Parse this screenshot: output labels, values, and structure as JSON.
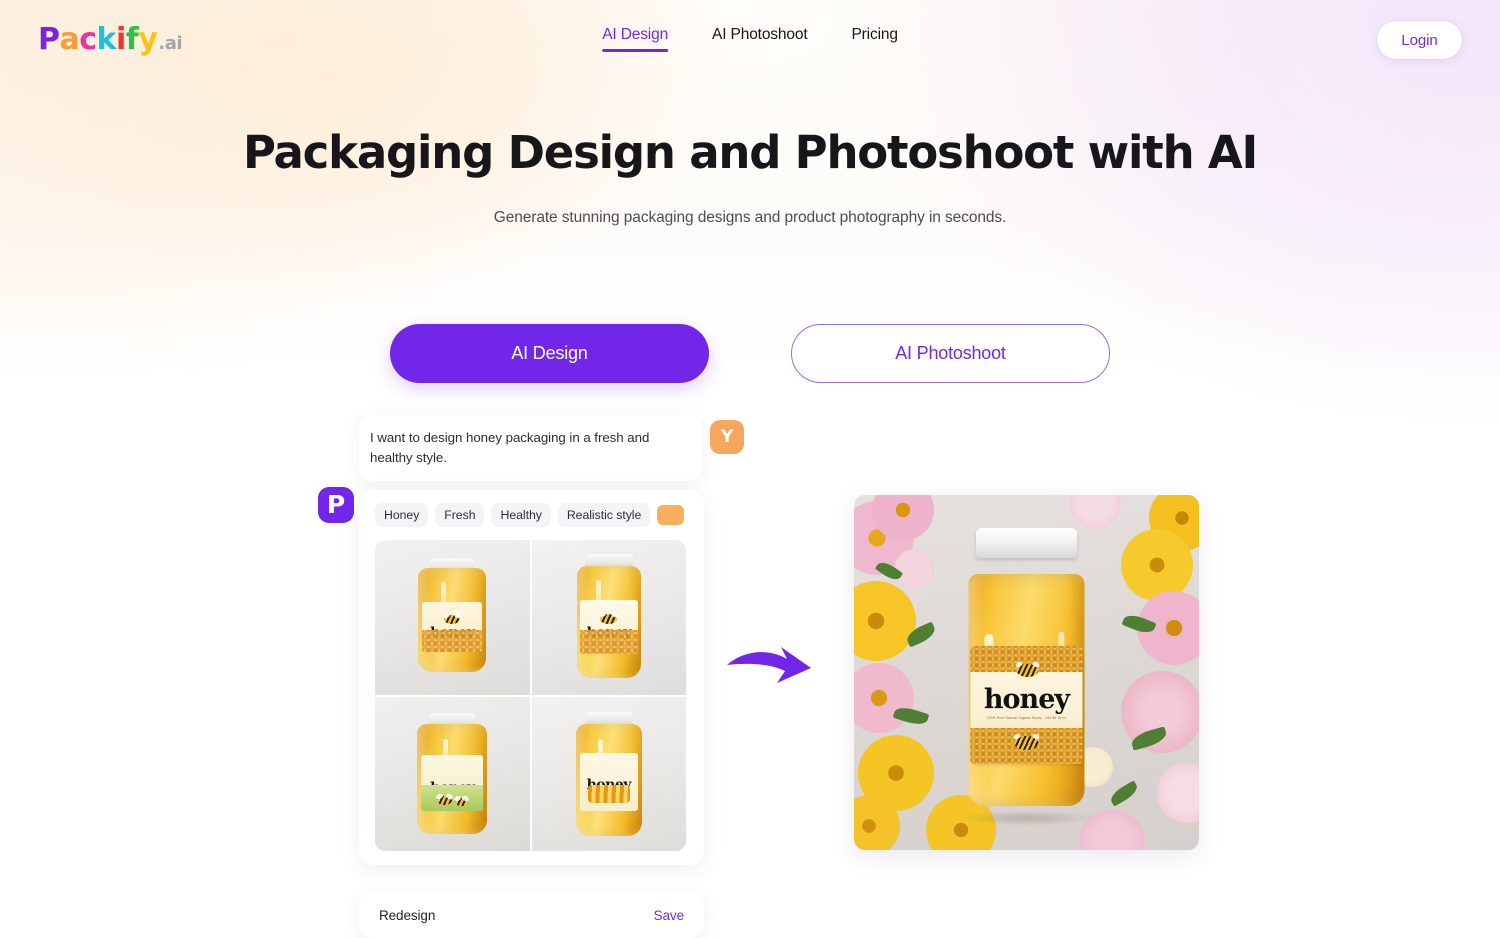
{
  "brand": {
    "name_letters": [
      "P",
      "a",
      "c",
      "k",
      "i",
      "f",
      "y"
    ],
    "suffix": ".ai",
    "colors": {
      "P": "#7a23e0",
      "a": "#fb9b3c",
      "c": "#ef2fa6",
      "k": "#1fbfe0",
      "i": "#f0352f",
      "f": "#2fc04a",
      "y": "#fcc417",
      "suffix": "#a5a3ab"
    }
  },
  "nav": {
    "items": [
      {
        "label": "AI Design",
        "active": true
      },
      {
        "label": "AI Photoshoot",
        "active": false
      },
      {
        "label": "Pricing",
        "active": false
      }
    ],
    "login_label": "Login"
  },
  "hero": {
    "title": "Packaging Design and Photoshoot with AI",
    "subtitle": "Generate stunning packaging designs and product photography in seconds."
  },
  "modes": {
    "primary_label": "AI Design",
    "secondary_label": "AI Photoshoot"
  },
  "chat": {
    "user_avatar_initial": "Y",
    "user_message": "I want to design honey packaging in a fresh and healthy style.",
    "bot_avatar_initial": "P",
    "tags": [
      "Honey",
      "Fresh",
      "Healthy",
      "Realistic style"
    ],
    "swatch_color": "#fbae5d",
    "grid_label_word": "honey",
    "results_alt": "Four generated honey jar packaging design variations"
  },
  "result": {
    "label_word": "honey",
    "label_fine_print": "100% Pure Natural Organic Honey  .  Net Wt 16 oz",
    "alt": "Honey jar product photo surrounded by pink and yellow flowers"
  },
  "actions": {
    "redesign_label": "Redesign",
    "save_label": "Save"
  },
  "theme": {
    "accent": "#7227e8",
    "bg_left": "#fdf0e0",
    "bg_right": "#f3e7fb",
    "text": "#16161b"
  }
}
